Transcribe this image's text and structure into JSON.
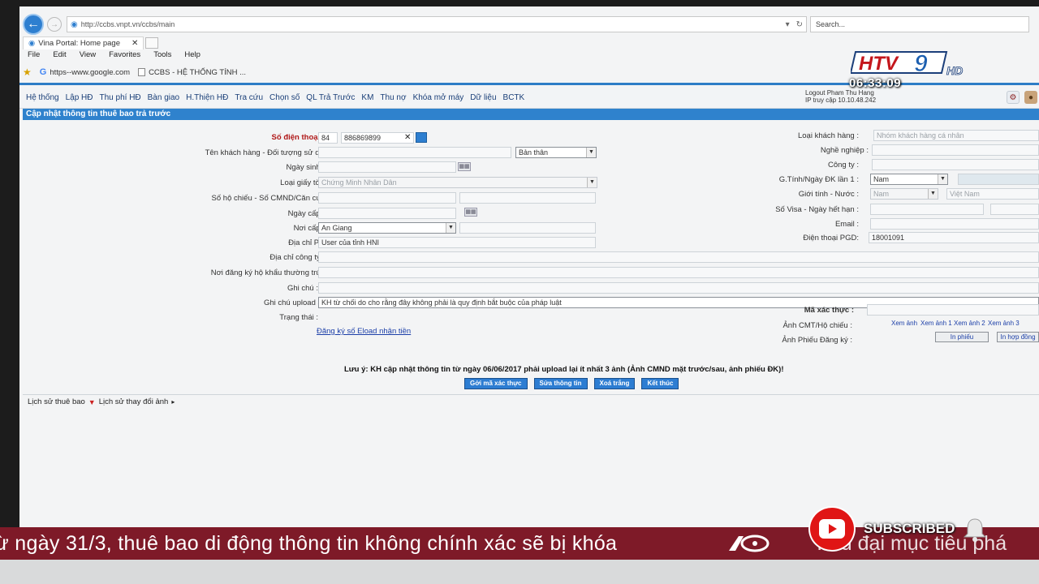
{
  "browser": {
    "url": "http://ccbs.vnpt.vn/ccbs/main",
    "search_placeholder": "Search...",
    "tab_title": "Vina Portal: Home page",
    "menu": [
      "File",
      "Edit",
      "View",
      "Favorites",
      "Tools",
      "Help"
    ],
    "favorites": [
      "https--www.google.com",
      "CCBS - HỆ THỐNG TÍNH ..."
    ]
  },
  "app": {
    "nav": [
      "Hệ thống",
      "Lập HĐ",
      "Thu phí HĐ",
      "Bàn giao",
      "H.Thiện HĐ",
      "Tra cứu",
      "Chọn số",
      "QL Trả Trước",
      "KM",
      "Thu nợ",
      "Khóa mở máy",
      "Dữ liệu",
      "BCTK"
    ],
    "user_line1": "Logout Pham Thu Hang",
    "user_line2": "IP truy cập 10.10.48.242",
    "page_title": "Cập nhật thông tin thuê bao trả trước"
  },
  "form": {
    "labels": {
      "phone": "Số điện thoại :",
      "name": "Tên khách hàng - Đối tượng sử dụng:",
      "dob": "Ngày sinh :",
      "doc_type": "Loại giấy tờ :",
      "passport": "Số hộ chiếu - Số CMND/Căn cước :",
      "issue_date": "Ngày cấp :",
      "issue_place": "Nơi cấp :",
      "pgd_address": "Địa chỉ PGD:",
      "company_address": "Địa chỉ công ty :",
      "household": "Nơi đăng ký hộ khẩu thường trú :",
      "note": "Ghi chú :",
      "upload_note": "Ghi chú upload ảnh:",
      "status": "Trạng thái :",
      "customer_type": "Loại khách hàng :",
      "occupation": "Nghề nghiệp :",
      "company": "Công ty :",
      "gender_date": "G.Tính/Ngày ĐK lần 1 :",
      "gender_country": "Giới tính - Nước :",
      "visa": "Số Visa - Ngày hết hạn :",
      "email": "Email :",
      "pgd_phone": "Điện thoại PGD:",
      "verify_code": "Mã xác thực :",
      "id_photo": "Ảnh CMT/Hộ chiếu :",
      "reg_photo": "Ảnh Phiếu Đăng ký :"
    },
    "values": {
      "phone_prefix": "84",
      "phone_number": "886869899",
      "relation": "Bản thân",
      "doc_type": "Chứng Minh Nhân Dân",
      "issue_place": "An Giang",
      "pgd_address": "User của tỉnh HNI",
      "upload_note": "KH từ chối do cho rằng đây không phải là quy định bắt buộc của pháp luật",
      "customer_type": "Nhóm khách hàng cá nhân",
      "gender": "Nam",
      "gender2": "Nam",
      "country": "Việt Nam",
      "pgd_phone": "18001091"
    },
    "eload_link": "Đăng ký số Eload nhận tiền",
    "photo_links": [
      "Xem ảnh",
      "Xem ảnh 1",
      "Xem ảnh 2",
      "Xem ảnh 3"
    ],
    "print_form": "In phiếu",
    "print_contract": "In hợp đồng",
    "notice": "Lưu ý: KH cập nhật thông tin từ ngày 06/06/2017 phải upload lại ít nhất 3 ảnh (Ảnh CMND mặt trước/sau, ảnh phiếu ĐK)!",
    "buttons": [
      "Gởi mã xác thực",
      "Sửa thông tin",
      "Xoá trắng",
      "Kết thúc"
    ],
    "history": [
      "Lịch sử thuê bao",
      "Lịch sử thay đổi ảnh"
    ]
  },
  "overlay": {
    "channel_logo": "HTV9 HD",
    "clock": "06:33:09",
    "ticker": "ừ ngày 31/3, thuê bao di động thông tin không chính xác sẽ bị khóa",
    "ticker_tail": "Tiêu đại mục tiêu phá",
    "subscribed": "SUBSCRIBED"
  },
  "colors": {
    "accent": "#2f82cd",
    "ticker_bg": "#7e1a28",
    "youtube_red": "#e01515"
  }
}
